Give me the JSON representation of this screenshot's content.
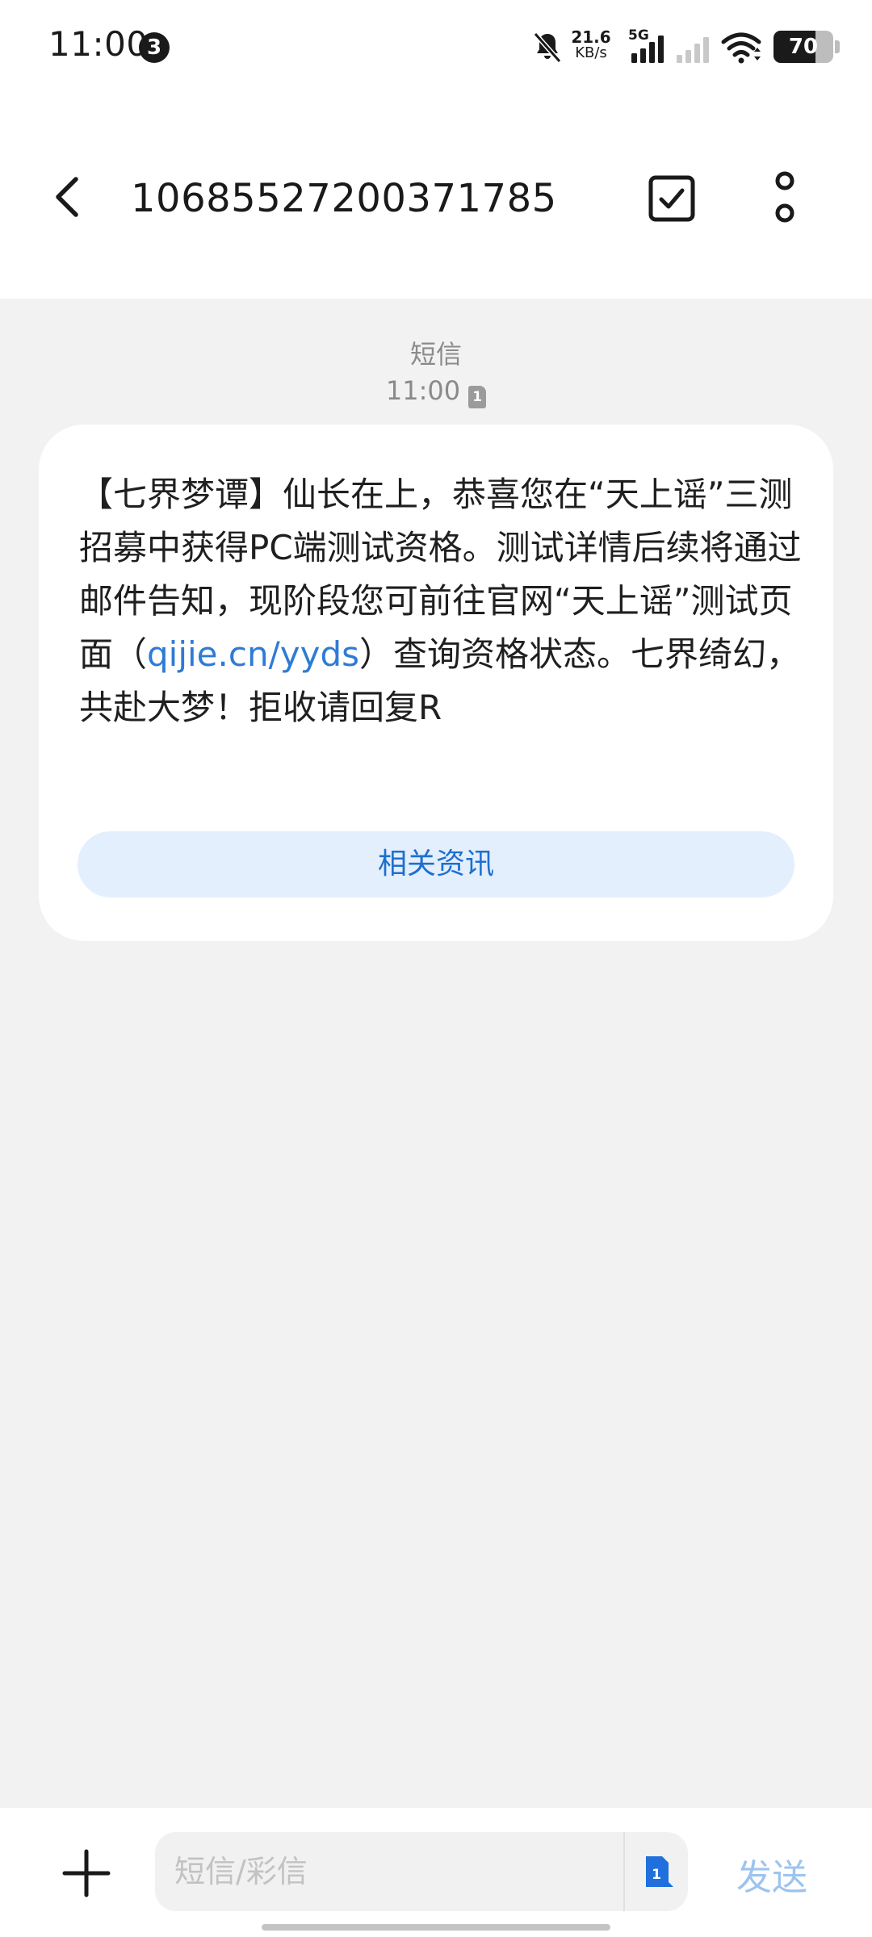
{
  "status_bar": {
    "time": "11:00",
    "notification_count": "3",
    "net_speed_value": "21.6",
    "net_speed_unit": "KB/s",
    "network_type": "5G",
    "battery_level": "70",
    "battery_fraction": 0.7
  },
  "header": {
    "title": "10685527200371785"
  },
  "message": {
    "type_label": "短信",
    "time": "11:00",
    "sim_slot": "1",
    "body_part1": "【七界梦谭】仙长在上，恭喜您在“天上谣”三测招募中获得PC端测试资格。测试详情后续将通过邮件告知，现阶段您可前往官网“天上谣”测试页面（",
    "link_text": "qijie.cn/yyds",
    "body_part2": "）查询资格状态。七界绮幻，共赴大梦！拒收请回复R",
    "related_button_label": "相关资讯"
  },
  "input_bar": {
    "placeholder": "短信/彩信",
    "sim_slot": "1",
    "send_label": "发送"
  },
  "colors": {
    "background": "#f2f2f2",
    "bubble": "#ffffff",
    "link": "#2e7bd6",
    "related_button_bg": "#e3effc",
    "related_button_text": "#1f6fcf",
    "send_disabled": "#9cc4ef"
  }
}
